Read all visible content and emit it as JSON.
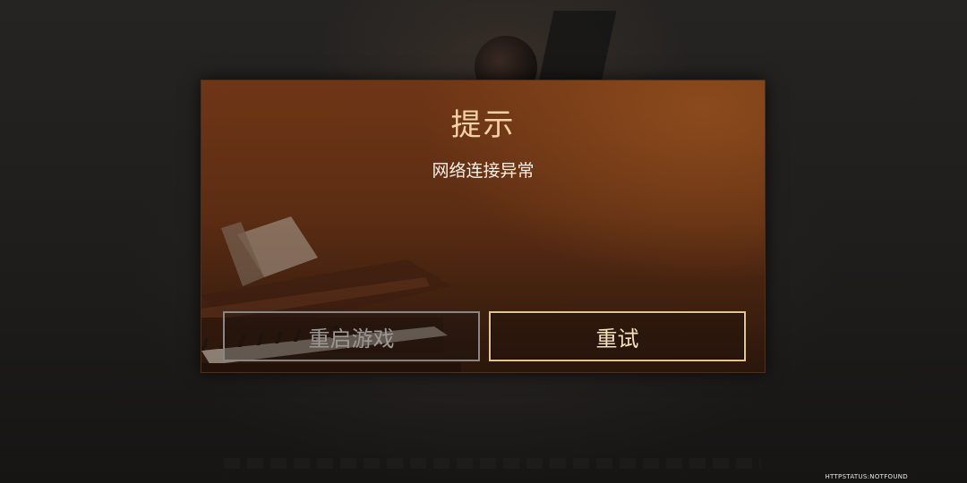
{
  "dialog": {
    "title": "提示",
    "message": "网络连接异常",
    "buttons": {
      "restart_label": "重启游戏",
      "retry_label": "重试"
    }
  },
  "footer": {
    "status": "HTTPSTATUS:NOTFOUND"
  },
  "colors": {
    "dialog_top": "#6f3616",
    "dialog_bottom": "#2a160b",
    "title": "#f2d3a6",
    "retry_border": "#e8c48b",
    "restart_border": "#8a8683"
  }
}
